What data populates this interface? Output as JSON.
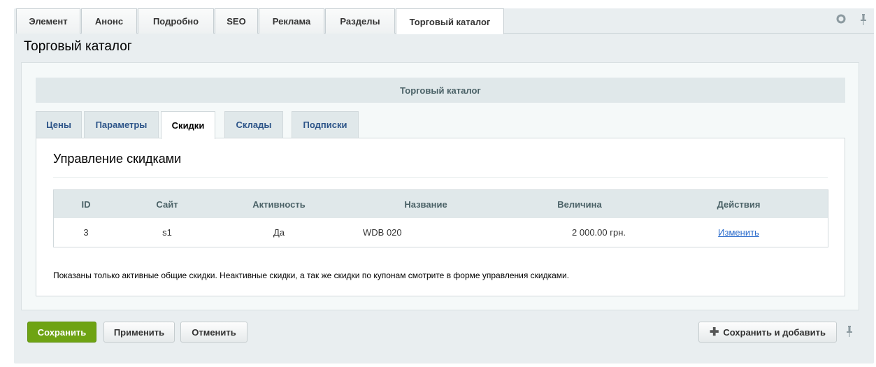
{
  "top_tabs": [
    "Элемент",
    "Анонс",
    "Подробно",
    "SEO",
    "Реклама",
    "Разделы",
    "Торговый каталог"
  ],
  "active_top_tab": "Торговый каталог",
  "page_title": "Торговый каталог",
  "section_header": "Торговый каталог",
  "sub_tabs": [
    "Цены",
    "Параметры",
    "Скидки",
    "Склады",
    "Подписки"
  ],
  "active_sub_tab": "Скидки",
  "panel_title": "Управление скидками",
  "table": {
    "headers": [
      "ID",
      "Сайт",
      "Активность",
      "Название",
      "Величина",
      "Действия"
    ],
    "rows": [
      {
        "id": "3",
        "site": "s1",
        "active": "Да",
        "name": "WDB 020",
        "value": "2 000.00 грн.",
        "action": "Изменить"
      }
    ]
  },
  "note": "Показаны только активные общие скидки. Неактивные скидки, а так же скидки по купонам смотрите в форме управления скидками.",
  "buttons": {
    "save": "Сохранить",
    "apply": "Применить",
    "cancel": "Отменить",
    "save_add": "Сохранить и добавить"
  },
  "icons": {
    "settings": "gear-icon",
    "pin": "pin-icon",
    "plus": "plus-icon"
  },
  "colors": {
    "save_button": "#6ea313",
    "link": "#2a6bcc",
    "sub_tab_text": "#2d5589",
    "header_bg": "#e0e8ea"
  }
}
